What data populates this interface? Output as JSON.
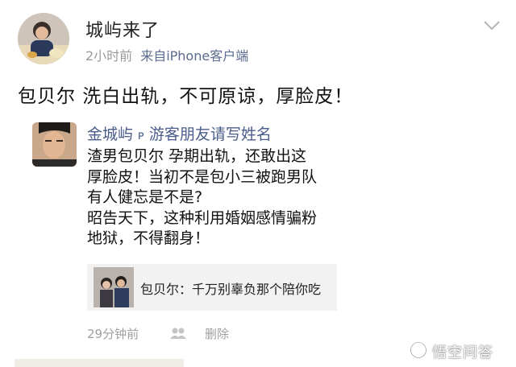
{
  "post": {
    "username": "城屿来了",
    "time": "2小时前",
    "source": "来自iPhone客户端",
    "text": "包贝尔 洗白出轨，不可原谅，厚脸皮！"
  },
  "repost": {
    "author": "金城屿",
    "author_tag_icon": "at-link-icon",
    "reply_to": "游客朋友请写姓名",
    "lines": [
      "渣男包贝尔 孕期出轨，还敢出这",
      "厚脸皮！当初不是包小三被跑男队",
      "有人健忘是不是?",
      "昭告天下，这种利用婚姻感情骗粉",
      "地狱，不得翻身！"
    ],
    "share_card": {
      "text": "包贝尔：千万别辜负那个陪你吃"
    },
    "time": "29分钟前",
    "delete_label": "删除"
  },
  "watermark": {
    "text": "悟空问答"
  }
}
